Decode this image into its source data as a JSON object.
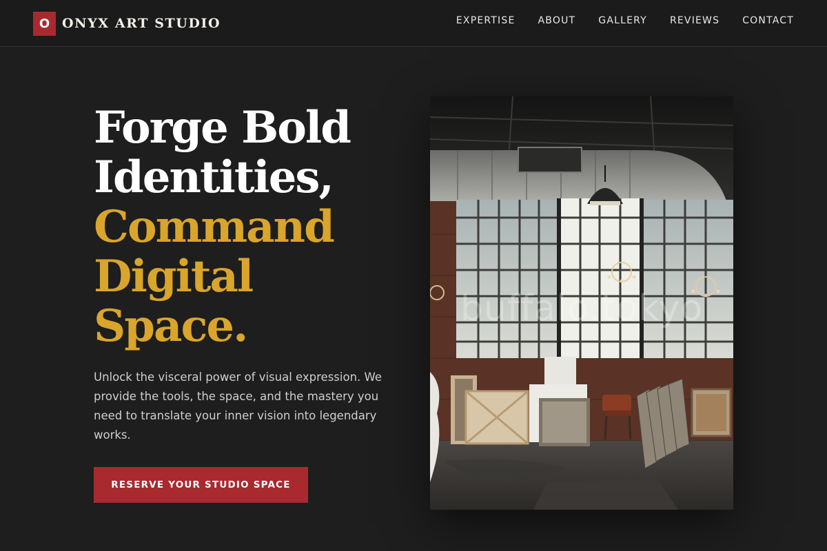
{
  "brand": {
    "mark": "O",
    "name": "ONYX ART STUDIO"
  },
  "nav": {
    "items": [
      {
        "label": "EXPERTISE"
      },
      {
        "label": "ABOUT"
      },
      {
        "label": "GALLERY"
      },
      {
        "label": "REVIEWS"
      },
      {
        "label": "CONTACT"
      }
    ]
  },
  "hero": {
    "headline": {
      "white_lines": [
        "Forge Bold",
        "Identities,"
      ],
      "gold_lines": [
        "Command",
        "Digital",
        "Space."
      ]
    },
    "body": "Unlock the visceral power of visual expression. We provide the tools, the space, and the mastery you need to translate your inner vision into legendary works.",
    "cta_label": "RESERVE YOUR STUDIO SPACE"
  },
  "image": {
    "watermark": "buffalo.tokyo"
  },
  "colors": {
    "background": "#1e1e1e",
    "accent_red": "#a82a2f",
    "accent_gold": "#d9a52a"
  }
}
